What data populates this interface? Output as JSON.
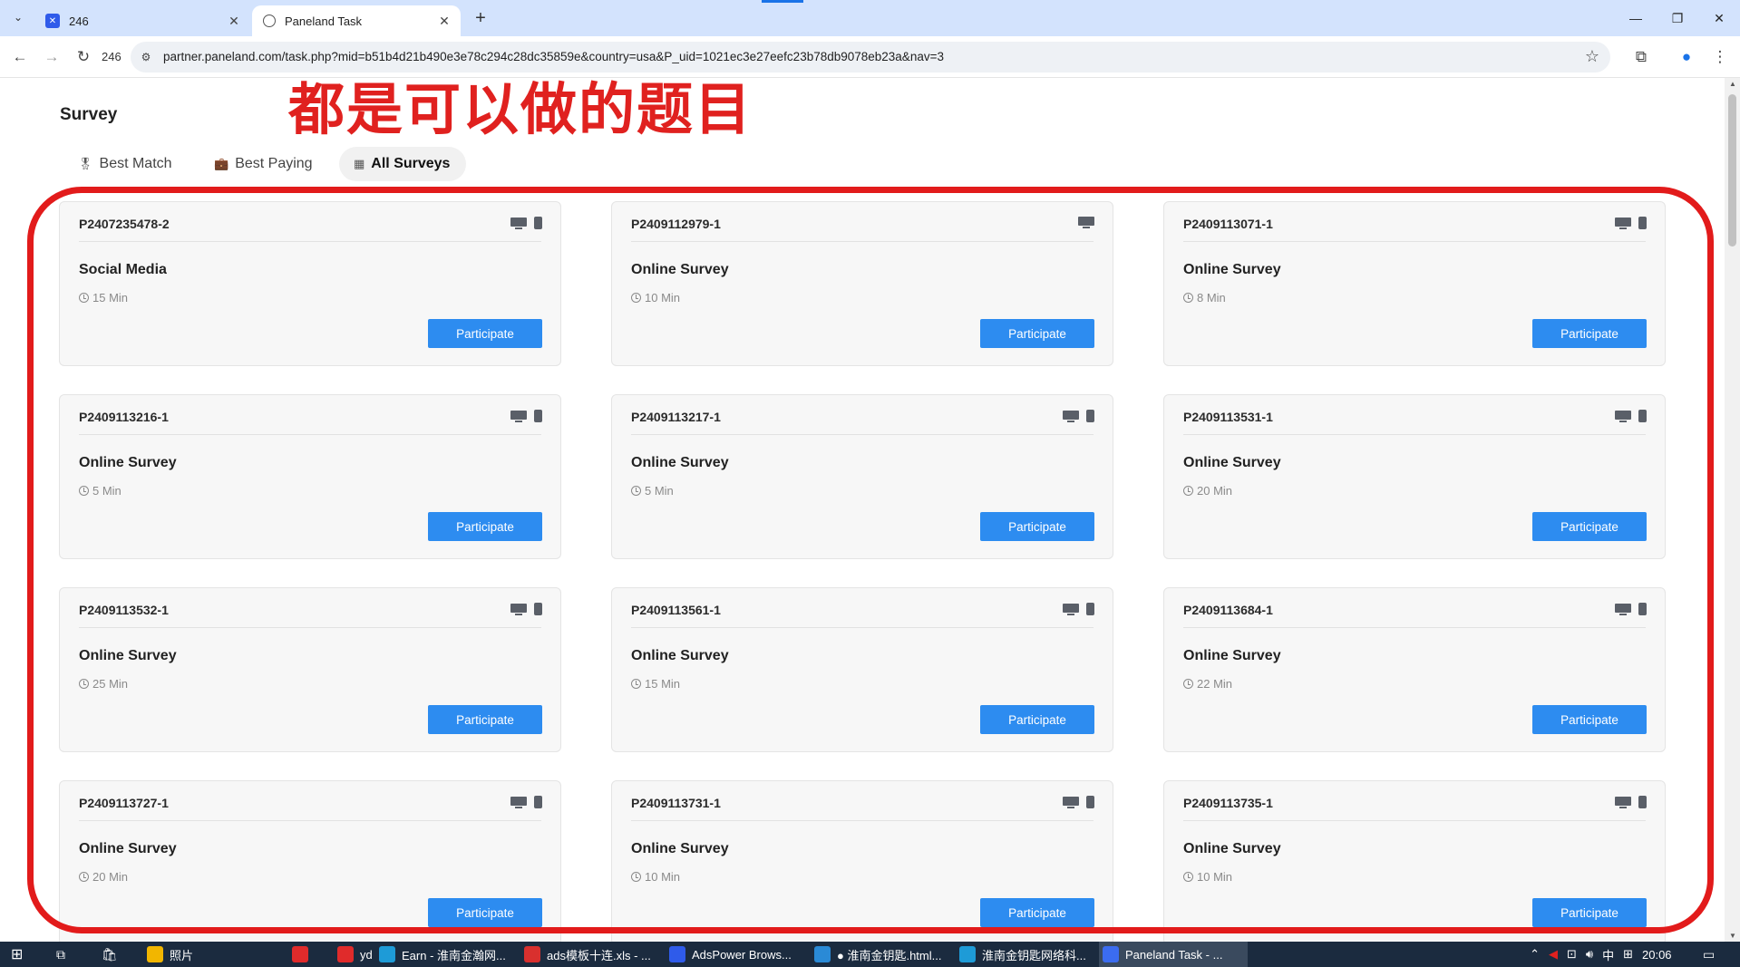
{
  "browser": {
    "tabs": [
      {
        "label": "246",
        "active": false,
        "favicon": "adspower-icon"
      },
      {
        "label": "Paneland Task",
        "active": true,
        "favicon": "globe-icon"
      }
    ],
    "new_tab_symbol": "+",
    "toolbar_profile_label": "246",
    "url": "partner.paneland.com/task.php?mid=b51b4d21b490e3e78c294c28dc35859e&country=usa&P_uid=1021ec3e27eefc23b78db9078eb23a&nav=3"
  },
  "page": {
    "title": "Survey",
    "annotation": "都是可以做的题目",
    "filters": [
      {
        "label": "Best Match",
        "icon": "award-icon",
        "active": false
      },
      {
        "label": "Best Paying",
        "icon": "briefcase-icon",
        "active": false
      },
      {
        "label": "All Surveys",
        "icon": "list-icon",
        "active": true
      }
    ],
    "participate_label": "Participate",
    "surveys": [
      {
        "code": "P2407235478-2",
        "title": "Social Media",
        "duration": "15 Min",
        "desktop": true,
        "mobile": true
      },
      {
        "code": "P2409112979-1",
        "title": "Online Survey",
        "duration": "10 Min",
        "desktop": true,
        "mobile": false
      },
      {
        "code": "P2409113071-1",
        "title": "Online Survey",
        "duration": "8 Min",
        "desktop": true,
        "mobile": true
      },
      {
        "code": "P2409113216-1",
        "title": "Online Survey",
        "duration": "5 Min",
        "desktop": true,
        "mobile": true
      },
      {
        "code": "P2409113217-1",
        "title": "Online Survey",
        "duration": "5 Min",
        "desktop": true,
        "mobile": true
      },
      {
        "code": "P2409113531-1",
        "title": "Online Survey",
        "duration": "20 Min",
        "desktop": true,
        "mobile": true
      },
      {
        "code": "P2409113532-1",
        "title": "Online Survey",
        "duration": "25 Min",
        "desktop": true,
        "mobile": true
      },
      {
        "code": "P2409113561-1",
        "title": "Online Survey",
        "duration": "15 Min",
        "desktop": true,
        "mobile": true
      },
      {
        "code": "P2409113684-1",
        "title": "Online Survey",
        "duration": "22 Min",
        "desktop": true,
        "mobile": true
      },
      {
        "code": "P2409113727-1",
        "title": "Online Survey",
        "duration": "20 Min",
        "desktop": true,
        "mobile": true
      },
      {
        "code": "P2409113731-1",
        "title": "Online Survey",
        "duration": "10 Min",
        "desktop": true,
        "mobile": true
      },
      {
        "code": "P2409113735-1",
        "title": "Online Survey",
        "duration": "10 Min",
        "desktop": true,
        "mobile": true
      }
    ]
  },
  "taskbar": {
    "items": [
      {
        "label": "照片",
        "icon": "photos-icon",
        "color": "#f2b600"
      },
      {
        "label": "",
        "icon": "netease-music-icon",
        "color": "#e02b2b"
      },
      {
        "label": "yd",
        "icon": "youdao-icon",
        "color": "#e02b2b"
      },
      {
        "label": "Earn - 淮南金瀚网...",
        "icon": "edge-icon",
        "color": "#1e9bd7"
      },
      {
        "label": "ads模板十连.xls - ...",
        "icon": "wps-icon",
        "color": "#d9302e"
      },
      {
        "label": "AdsPower Brows...",
        "icon": "adspower-icon",
        "color": "#2f5bea"
      },
      {
        "label": "● 淮南金钥匙.html...",
        "icon": "vscode-icon",
        "color": "#2a8ad6"
      },
      {
        "label": "淮南金钥匙网络科...",
        "icon": "edge-icon",
        "color": "#1e9bd7"
      },
      {
        "label": "Paneland Task - ...",
        "icon": "chrome-profile-icon",
        "color": "#3b6cf0"
      }
    ],
    "tray_ime": "中",
    "time": "20:06"
  }
}
